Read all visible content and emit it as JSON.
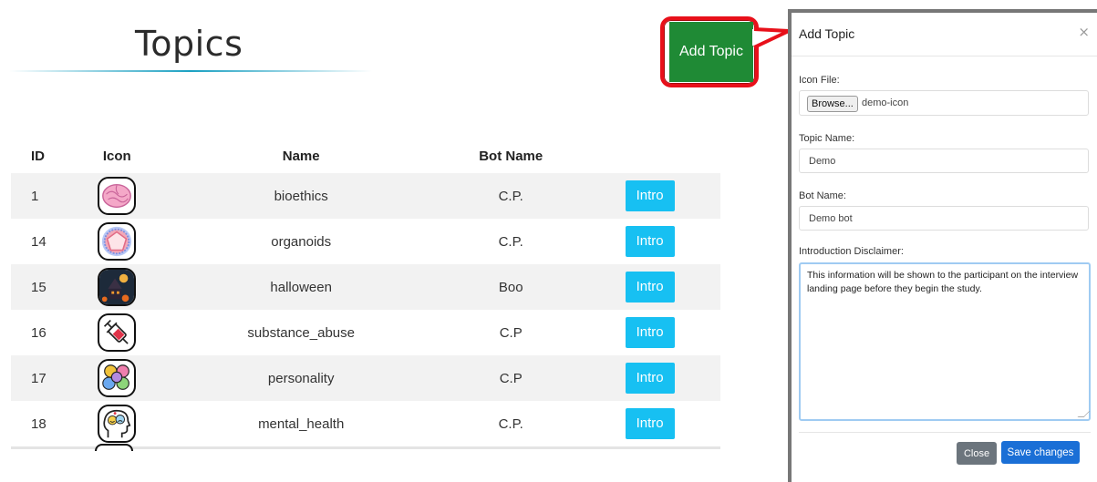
{
  "page": {
    "title": "Topics"
  },
  "toolbar": {
    "add_topic_label": "Add Topic"
  },
  "table": {
    "headers": {
      "id": "ID",
      "icon": "Icon",
      "name": "Name",
      "bot_name": "Bot Name"
    },
    "rows": [
      {
        "id": "1",
        "icon": "brain-icon",
        "name": "bioethics",
        "bot_name": "C.P.",
        "action": "Intro"
      },
      {
        "id": "14",
        "icon": "organoid-icon",
        "name": "organoids",
        "bot_name": "C.P.",
        "action": "Intro"
      },
      {
        "id": "15",
        "icon": "haunted-house-icon",
        "name": "halloween",
        "bot_name": "Boo",
        "action": "Intro"
      },
      {
        "id": "16",
        "icon": "syringe-icon",
        "name": "substance_abuse",
        "bot_name": "C.P",
        "action": "Intro"
      },
      {
        "id": "17",
        "icon": "puzzle-brain-icon",
        "name": "personality",
        "bot_name": "C.P",
        "action": "Intro"
      },
      {
        "id": "18",
        "icon": "head-mind-icon",
        "name": "mental_health",
        "bot_name": "C.P.",
        "action": "Intro"
      }
    ]
  },
  "modal": {
    "title": "Add Topic",
    "close_glyph": "×",
    "icon_file": {
      "label": "Icon File:",
      "browse_label": "Browse...",
      "file_name": "demo-icon"
    },
    "topic_name": {
      "label": "Topic Name:",
      "value": "Demo"
    },
    "bot_name": {
      "label": "Bot Name:",
      "value": "Demo bot"
    },
    "disclaimer": {
      "label": "Introduction Disclaimer:",
      "value": "This information will be shown to the participant on the interview landing page before they begin the study."
    },
    "close_label": "Close",
    "save_label": "Save changes"
  },
  "colors": {
    "add_topic_bg": "#1f8a35",
    "highlight_border": "#e8101a",
    "intro_bg": "#17c0f2",
    "save_bg": "#1a6fd6",
    "close_bg": "#6c757d"
  }
}
